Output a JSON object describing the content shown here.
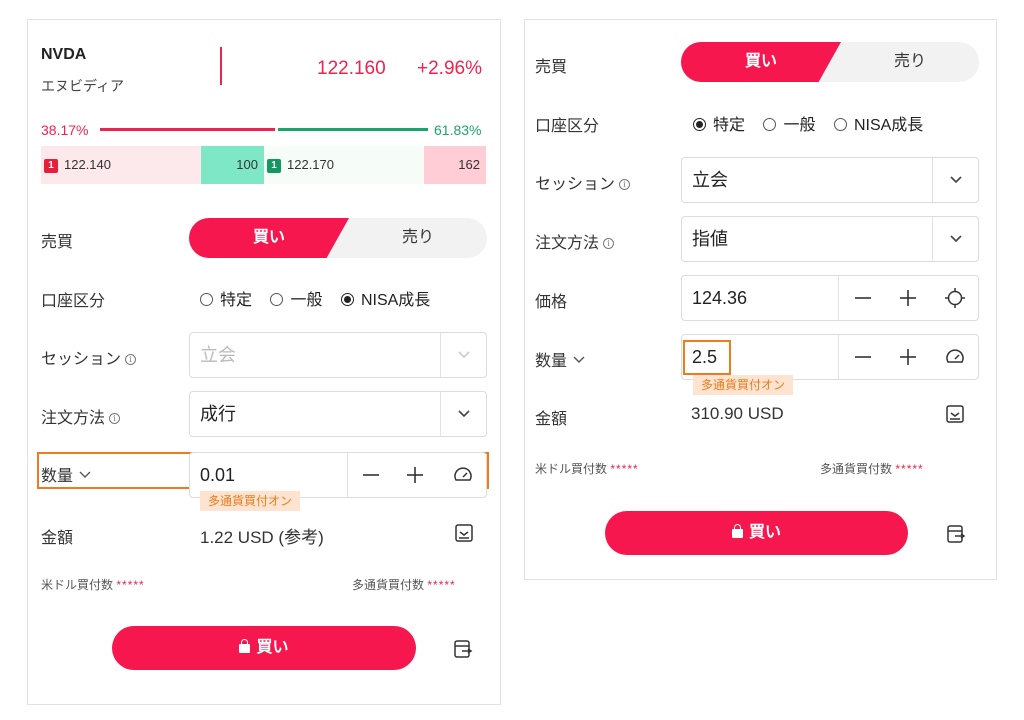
{
  "left": {
    "symbol": "NVDA",
    "company": "エヌビディア",
    "price": "122.160",
    "change": "+2.96%",
    "bid_pct": "38.17%",
    "ask_pct": "61.83%",
    "bid_price": "122.140",
    "bid_qty": "100",
    "ask_price": "122.170",
    "ask_qty": "162",
    "badge_label": "1",
    "side_label": "売買",
    "buy_label": "買い",
    "sell_label": "売り",
    "account_label": "口座区分",
    "account_options": [
      "特定",
      "一般",
      "NISA成長"
    ],
    "account_selected": "NISA成長",
    "session_label": "セッション",
    "session_value": "立会",
    "order_method_label": "注文方法",
    "order_method_value": "成行",
    "qty_label": "数量",
    "qty_value": "0.01",
    "multi_currency_tip": "多通貨買付オン",
    "amount_label": "金額",
    "amount_value": "1.22 USD (参考)",
    "usd_count_label": "米ドル買付数",
    "usd_count_value": "*****",
    "multi_count_label": "多通貨買付数",
    "multi_count_value": "*****",
    "submit_label": "買い"
  },
  "right": {
    "side_label": "売買",
    "buy_label": "買い",
    "sell_label": "売り",
    "account_label": "口座区分",
    "account_options": [
      "特定",
      "一般",
      "NISA成長"
    ],
    "account_selected": "特定",
    "session_label": "セッション",
    "session_value": "立会",
    "order_method_label": "注文方法",
    "order_method_value": "指値",
    "price_label": "価格",
    "price_value": "124.36",
    "qty_label": "数量",
    "qty_value": "2.5",
    "multi_currency_tip": "多通貨買付オン",
    "amount_label": "金額",
    "amount_value": "310.90 USD",
    "usd_count_label": "米ドル買付数",
    "usd_count_value": "*****",
    "multi_count_label": "多通貨買付数",
    "multi_count_value": "*****",
    "submit_label": "買い"
  },
  "colors": {
    "accent": "#f6174f",
    "up": "#f0224e",
    "down": "#1ba36c",
    "highlight": "#ee7c1c"
  },
  "icons": [
    "chevron-down-icon",
    "info-icon",
    "minus-icon",
    "plus-icon",
    "target-icon",
    "gauge-icon",
    "calculator-icon",
    "lock-icon",
    "swap-icon"
  ]
}
